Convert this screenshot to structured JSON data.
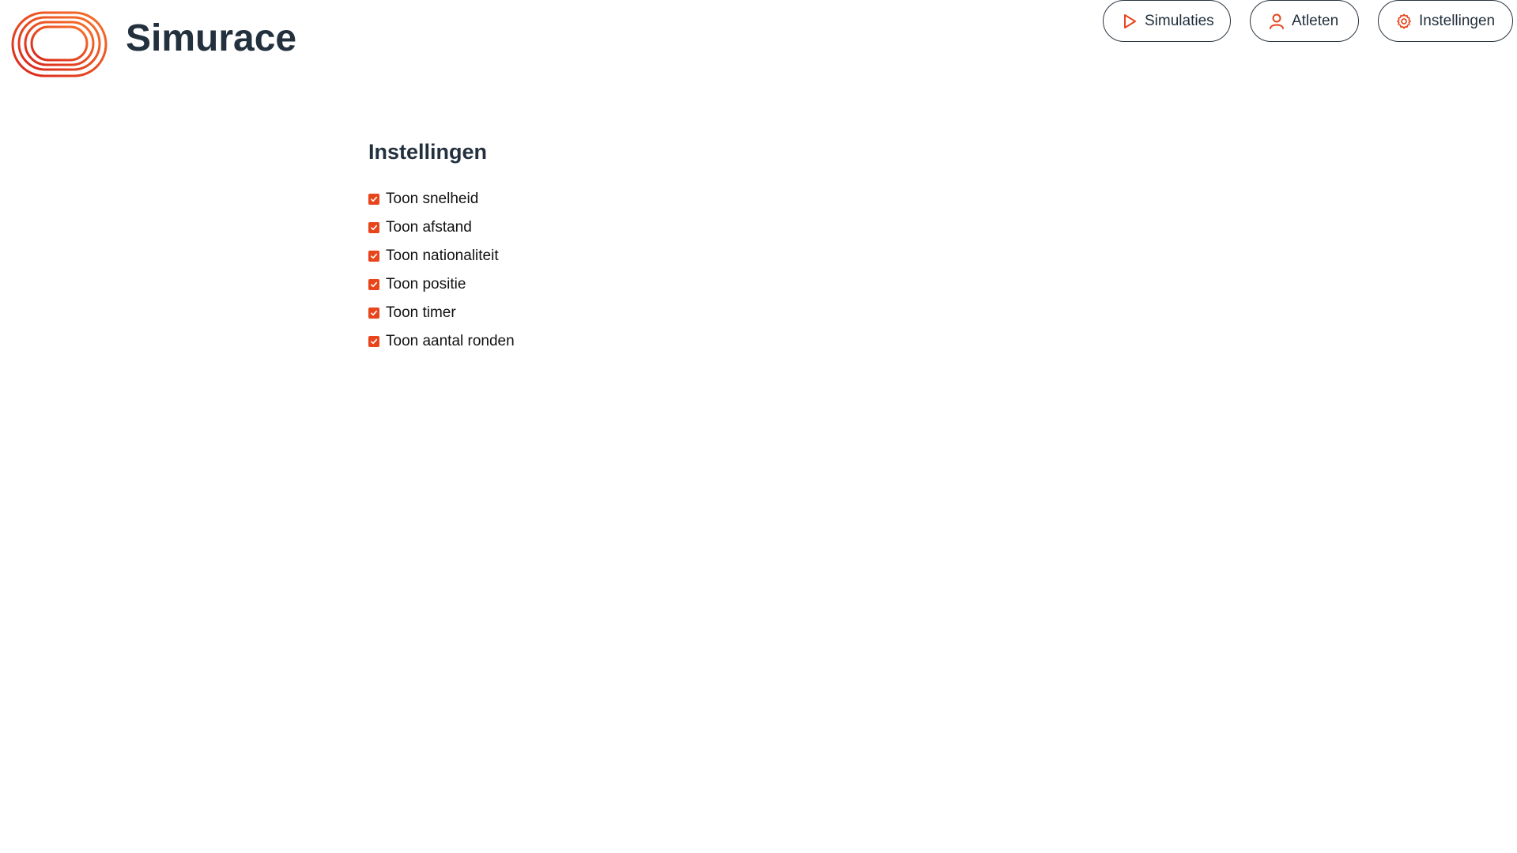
{
  "app": {
    "brand_name": "Simurace"
  },
  "nav": {
    "items": [
      {
        "label": "Simulaties",
        "icon": "play-icon"
      },
      {
        "label": "Atleten",
        "icon": "user-icon"
      },
      {
        "label": "Instellingen",
        "icon": "gear-icon"
      }
    ]
  },
  "settings": {
    "title": "Instellingen",
    "options": [
      {
        "label": "Toon snelheid",
        "checked": true
      },
      {
        "label": "Toon afstand",
        "checked": true
      },
      {
        "label": "Toon nationaliteit",
        "checked": true
      },
      {
        "label": "Toon positie",
        "checked": true
      },
      {
        "label": "Toon timer",
        "checked": true
      },
      {
        "label": "Toon aantal ronden",
        "checked": true
      }
    ]
  },
  "colors": {
    "accent": "#e8451c",
    "text_dark": "#23313f"
  }
}
